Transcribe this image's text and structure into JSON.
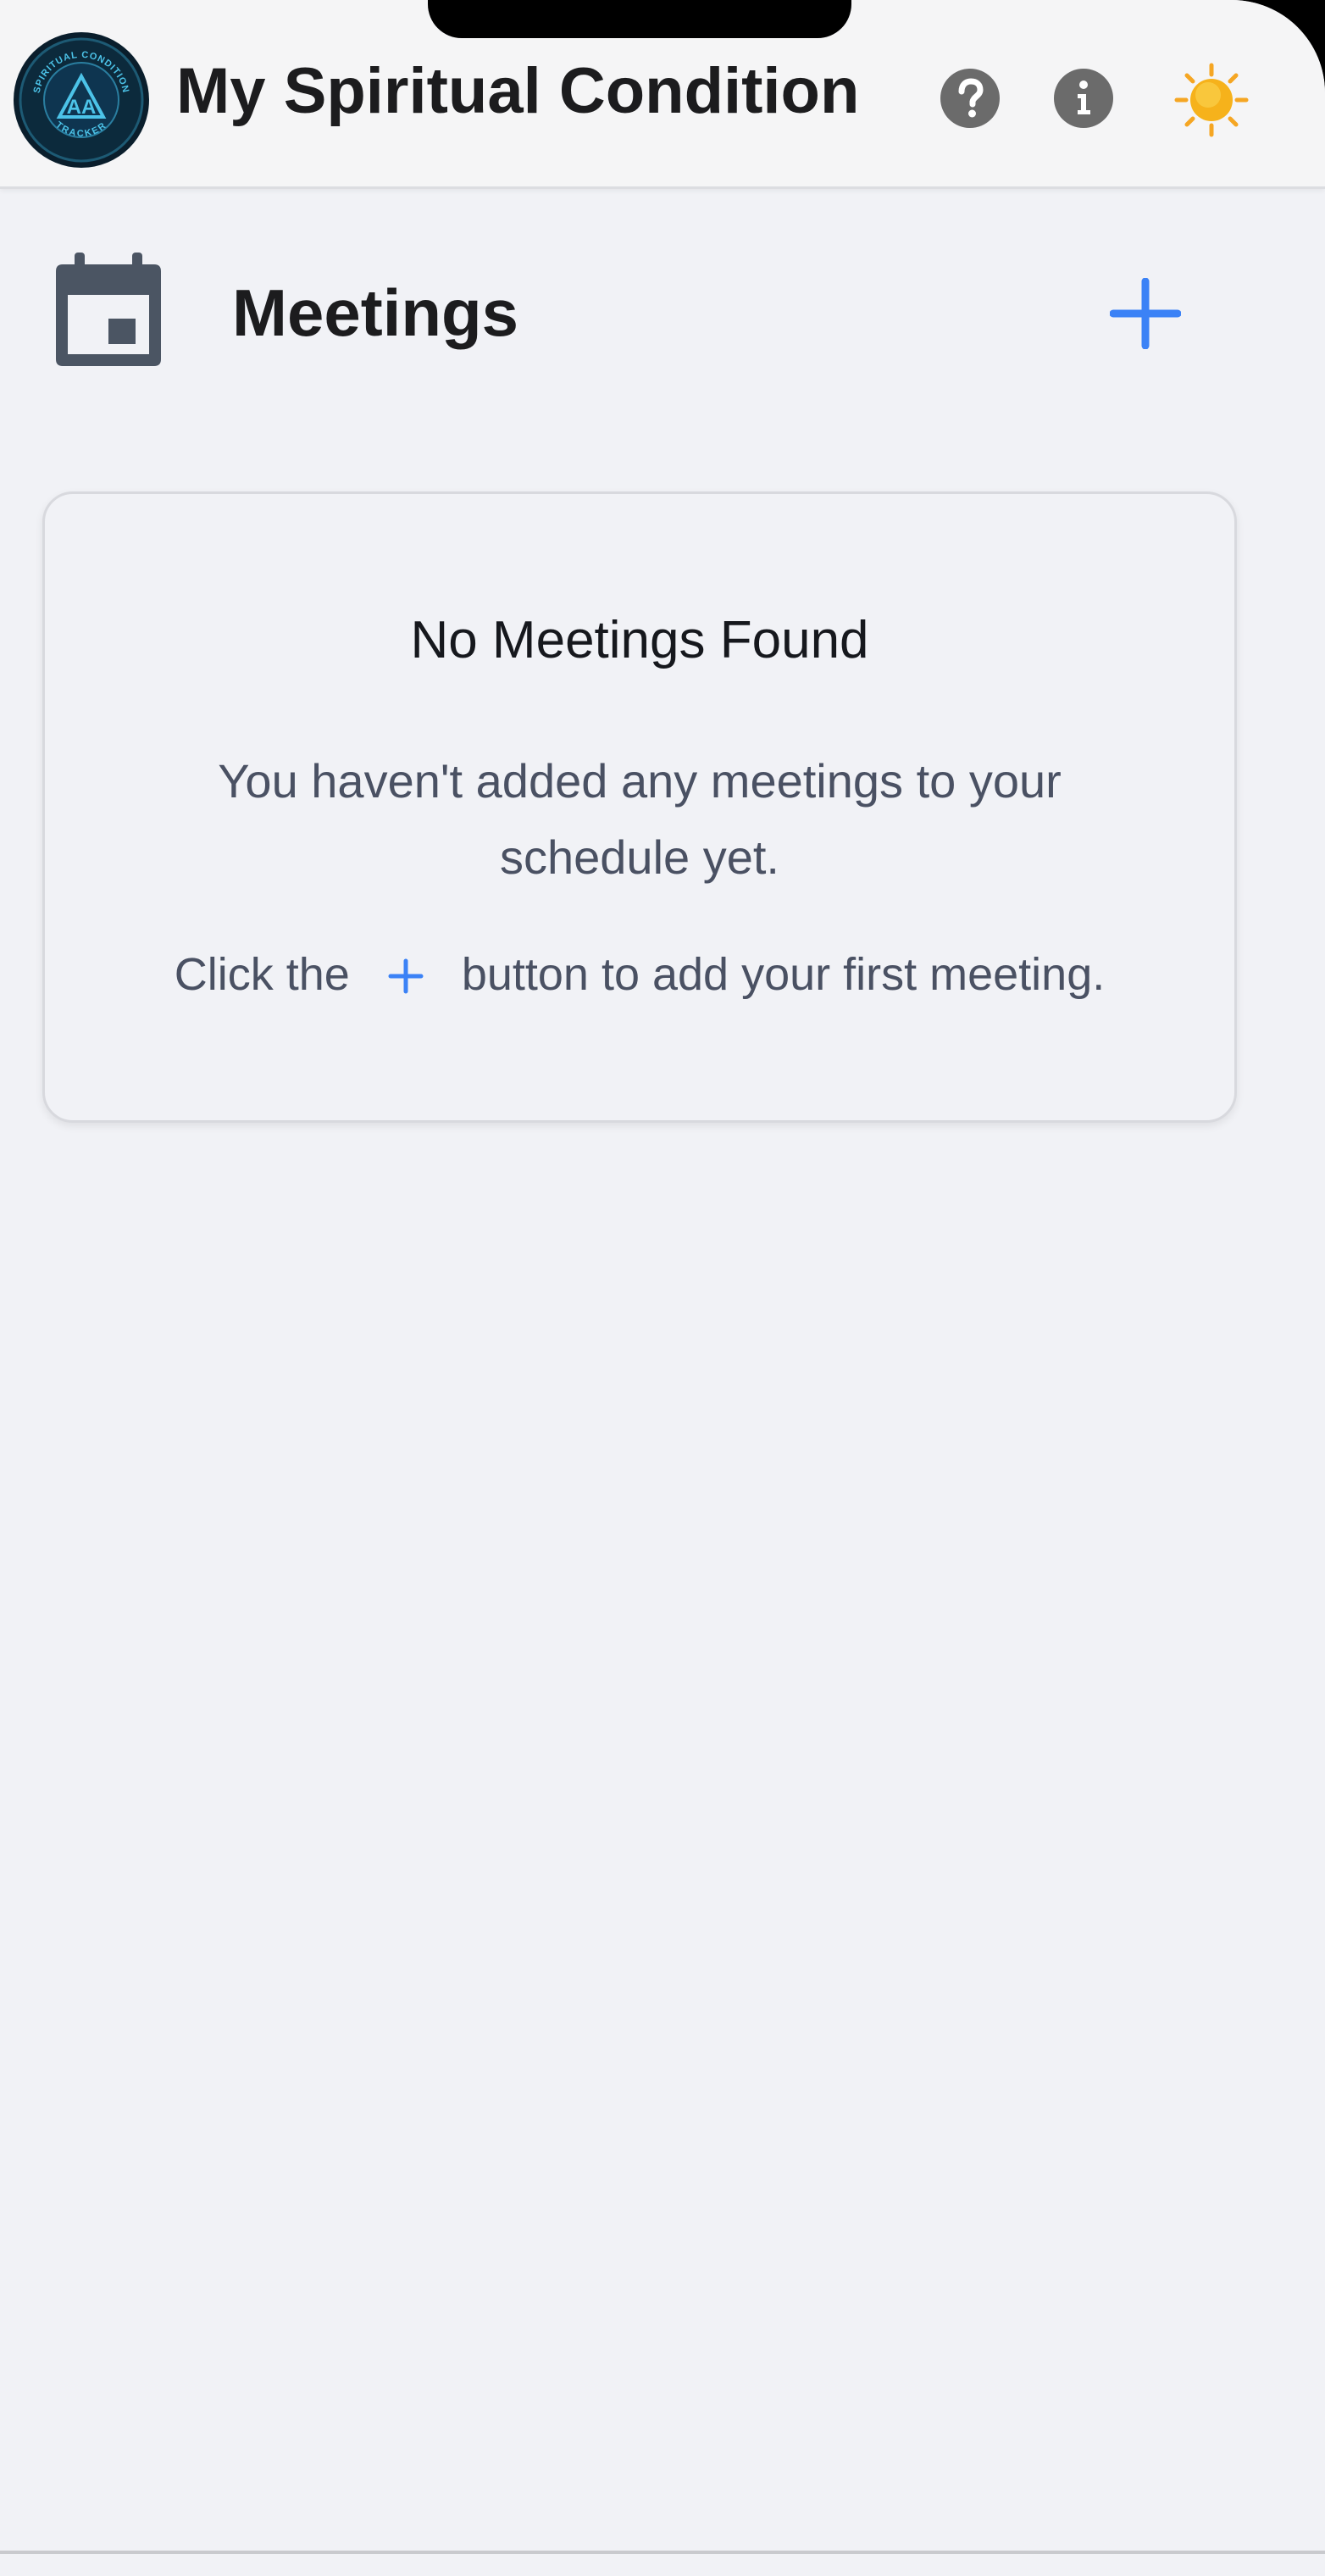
{
  "header": {
    "title": "My Spiritual Condition",
    "logo_text_top": "SPIRITUAL CONDITION",
    "logo_text_bottom": "TRACKER",
    "icons": {
      "help": "question-circle-icon",
      "info": "info-circle-icon",
      "theme": "sun-icon"
    }
  },
  "meetings": {
    "title": "Meetings",
    "icon": "calendar-icon",
    "add_icon": "plus-icon"
  },
  "empty_state": {
    "title": "No Meetings Found",
    "description": "You haven't added any meetings to your schedule yet.",
    "hint_before": "Click the",
    "hint_after": "button to add your first meeting."
  },
  "colors": {
    "accent": "#3b82f6",
    "background": "#f1f2f6",
    "header_bg": "#f5f5f6",
    "icon_gray": "#6b6b6b",
    "calendar_gray": "#4b5563",
    "text_dark": "#1c1c1e",
    "text_muted": "#4a5163",
    "sun": "#f6b21b"
  }
}
